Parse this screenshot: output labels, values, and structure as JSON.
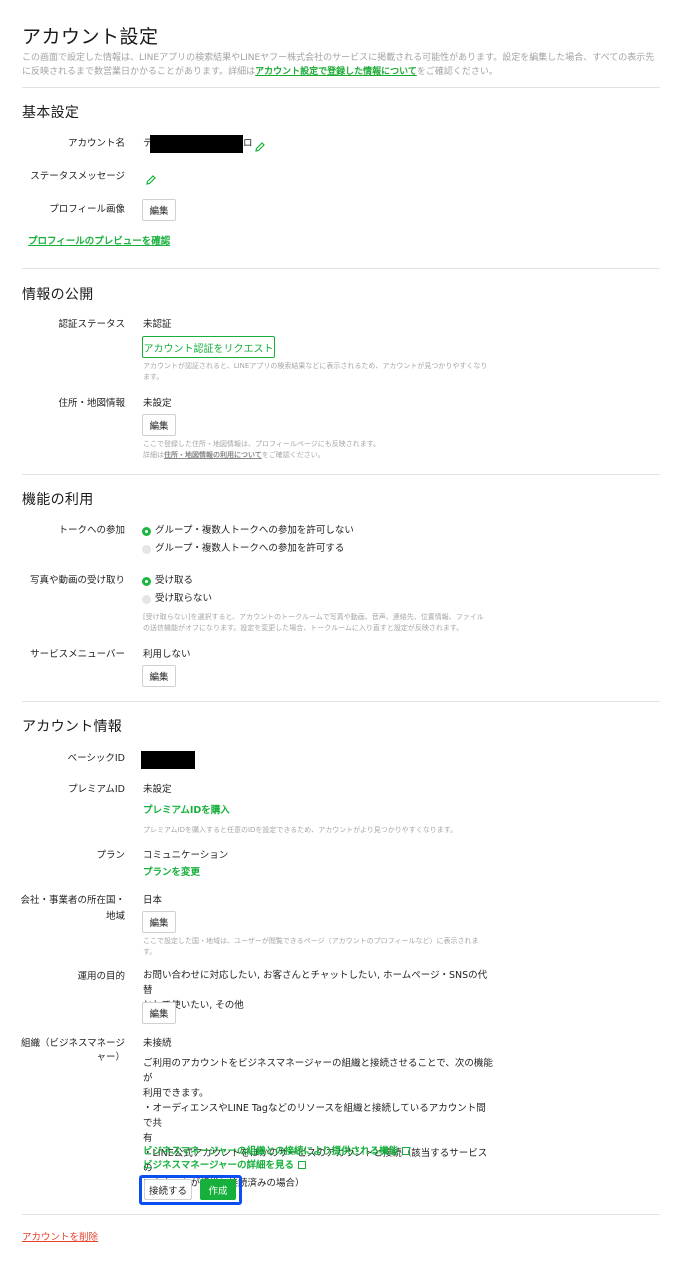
{
  "page": {
    "title": "アカウント設定",
    "intro_text": "この画面で設定した情報は、LINEアプリの検索結果やLINEヤフー株式会社のサービスに掲載される可能性があります。設定を編集した場合、すべての表示先に反映されるまで数営業日かかることがあります。詳細は",
    "intro_link": "アカウント設定で登録した情報について",
    "intro_suffix": "をご確認ください。"
  },
  "basic": {
    "heading": "基本設定",
    "account_name_label": "アカウント名",
    "account_name_prefix": "テ",
    "account_name_suffix": "ロ",
    "status_message_label": "ステータスメッセージ",
    "profile_image_label": "プロフィール画像",
    "edit_label": "編集",
    "preview_link": "プロフィールのプレビューを確認"
  },
  "publish": {
    "heading": "情報の公開",
    "verify_label": "認証ステータス",
    "verify_value": "未認証",
    "verify_button": "アカウント認証をリクエスト",
    "verify_note": "アカウントが認証されると、LINEアプリの検索結果などに表示されるため、アカウントが見つかりやすくなります。",
    "address_label": "住所・地図情報",
    "address_value": "未設定",
    "edit_label": "編集",
    "address_note1": "ここで登録した住所・地図情報は、プロフィールページにも反映されます。",
    "address_note2_prefix": "詳細は",
    "address_note2_link": "住所・地図情報の利用について",
    "address_note2_suffix": "をご確認ください。"
  },
  "features": {
    "heading": "機能の利用",
    "group_label": "トークへの参加",
    "group_opt1": "グループ・複数人トークへの参加を許可しない",
    "group_opt2": "グループ・複数人トークへの参加を許可する",
    "media_label": "写真や動画の受け取り",
    "media_opt1": "受け取る",
    "media_opt2": "受け取らない",
    "media_note": "[受け取らない]を選択すると、アカウントのトークルームで写真や動画、音声、連絡先、位置情報、ファイルの送信機能がオフになります。設定を変更した場合、トークルームに入り直すと設定が反映されます。",
    "menu_label": "サービスメニューバー",
    "menu_value": "利用しない",
    "edit_label": "編集"
  },
  "account_info": {
    "heading": "アカウント情報",
    "basic_id_label": "ベーシックID",
    "premium_id_label": "プレミアムID",
    "premium_id_value": "未設定",
    "premium_buy": "プレミアムIDを購入",
    "premium_note": "プレミアムIDを購入すると任意のIDを設定できるため、アカウントがより見つかりやすくなります。",
    "plan_label": "プラン",
    "plan_value": "コミュニケーション",
    "plan_change": "プランを変更",
    "country_label_1": "会社・事業者の所在国・",
    "country_label_2": "地域",
    "country_value": "日本",
    "country_note": "ここで設定した国・地域は、ユーザーが閲覧できるページ（アカウントのプロフィールなど）に表示されます。",
    "purpose_label": "運用の目的",
    "purpose_value_1": "お問い合わせに対応したい, お客さんとチャットしたい, ホームページ・SNSの代替",
    "purpose_value_2": "として使いたい, その他",
    "org_label_1": "組織（ビジネスマネージ",
    "org_label_2": "ャー）",
    "org_value": "未接続",
    "org_desc_1": "ご利用のアカウントをビジネスマネージャーの組織と接続させることで、次の機能が",
    "org_desc_2": "利用できます。",
    "org_desc_3": "・オーディエンスやLINE Tagなどのリソースを組織と接続しているアカウント間で共",
    "org_desc_4": "有",
    "org_desc_5": "・LINE公式アカウントをほかのサービスのアカウントと接続（該当するサービスの",
    "org_desc_6": "アカウントが組織と接続済みの場合）",
    "org_link1": "ビジネスマネージャーの組織との接続により提供される機能",
    "org_link2": "ビジネスマネージャーの詳細を見る",
    "connect_button": "接続する",
    "create_button": "作成",
    "edit_label": "編集"
  },
  "danger": {
    "delete_link": "アカウントを削除"
  },
  "colors": {
    "accent": "#17b03c",
    "danger": "#e8412c",
    "highlight": "#0a4ff0"
  }
}
